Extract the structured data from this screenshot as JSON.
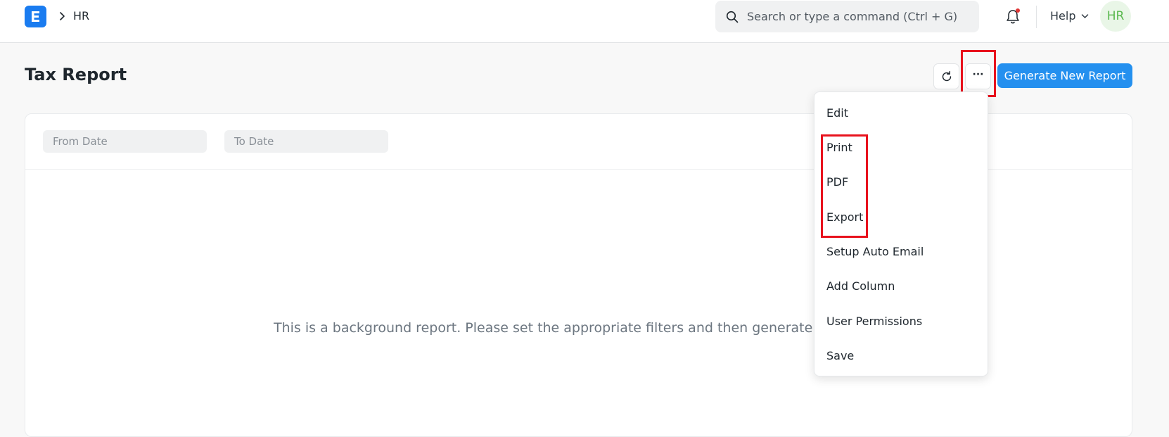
{
  "navbar": {
    "breadcrumb": "HR",
    "search_placeholder": "Search or type a command (Ctrl + G)",
    "help_label": "Help",
    "avatar_initials": "HR"
  },
  "page": {
    "title": "Tax Report",
    "generate_button": "Generate New Report",
    "more_button": "···"
  },
  "filters": {
    "from_date": "From Date",
    "to_date": "To Date"
  },
  "empty_message": "This is a background report. Please set the appropriate filters and then generate a new one.",
  "menu": {
    "items": [
      "Edit",
      "Print",
      "PDF",
      "Export",
      "Setup Auto Email",
      "Add Column",
      "User Permissions",
      "Save"
    ]
  },
  "colors": {
    "accent": "#2490ef",
    "highlight": "#e8121d"
  }
}
